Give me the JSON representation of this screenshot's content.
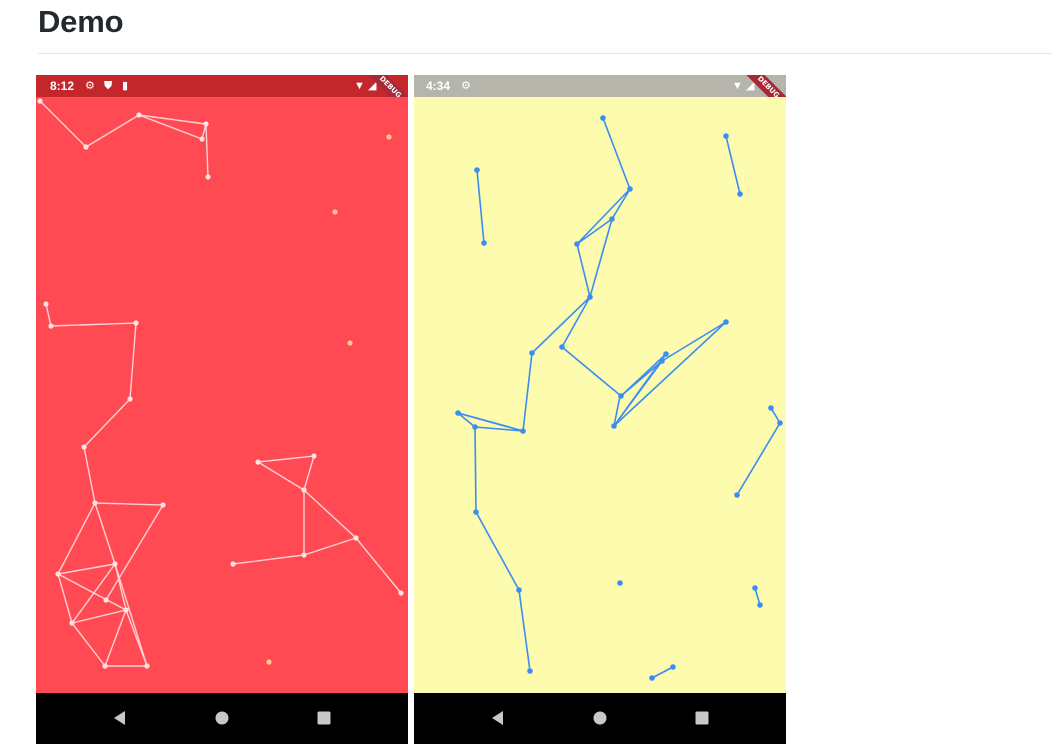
{
  "page": {
    "title": "Demo"
  },
  "phones": [
    {
      "time": "8:12",
      "debug_label": "DEBUG",
      "background_color": "#ff4a54",
      "statusbar_color": "#c3272b",
      "line_color": "#ffdede",
      "status_icons_left": [
        "gear-icon",
        "shield-icon",
        "sd-card-icon"
      ],
      "status_icons_right": [
        "wifi-icon",
        "signal-icon",
        "battery-icon"
      ]
    },
    {
      "time": "4:34",
      "debug_label": "DEBUG",
      "background_color": "#fcfbae",
      "statusbar_color": "#b5b5ac",
      "line_color": "#3b8cf5",
      "status_icons_left": [
        "gear-icon"
      ],
      "status_icons_right": [
        "wifi-icon",
        "signal-icon",
        "battery-icon"
      ]
    }
  ],
  "navigation_buttons": [
    "back-button",
    "home-button",
    "recents-button"
  ]
}
